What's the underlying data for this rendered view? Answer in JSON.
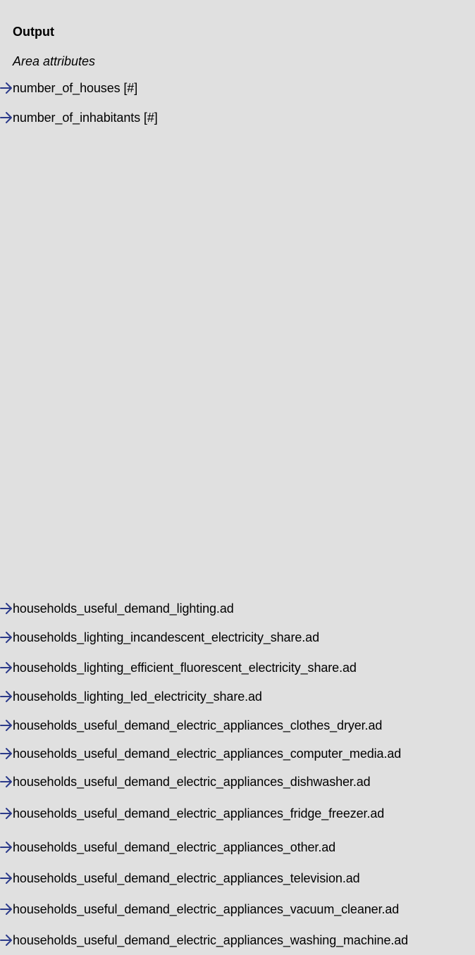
{
  "heading": "Output",
  "subheading": "Area attributes",
  "arrow_icon": "arrow-right-icon",
  "colors": {
    "background": "#e0e0e0",
    "arrow": "#2b3a8a",
    "text": "#000000"
  },
  "area_attributes": [
    "number_of_houses [#]",
    "number_of_inhabitants [#]"
  ],
  "outputs": [
    "households_useful_demand_lighting.ad",
    "households_lighting_incandescent_electricity_share.ad",
    "households_lighting_efficient_fluorescent_electricity_share.ad",
    "households_lighting_led_electricity_share.ad",
    "households_useful_demand_electric_appliances_clothes_dryer.ad",
    "households_useful_demand_electric_appliances_computer_media.ad",
    "households_useful_demand_electric_appliances_dishwasher.ad",
    "households_useful_demand_electric_appliances_fridge_freezer.ad",
    "households_useful_demand_electric_appliances_other.ad",
    "households_useful_demand_electric_appliances_television.ad",
    "households_useful_demand_electric_appliances_vacuum_cleaner.ad",
    "households_useful_demand_electric_appliances_washing_machine.ad"
  ]
}
